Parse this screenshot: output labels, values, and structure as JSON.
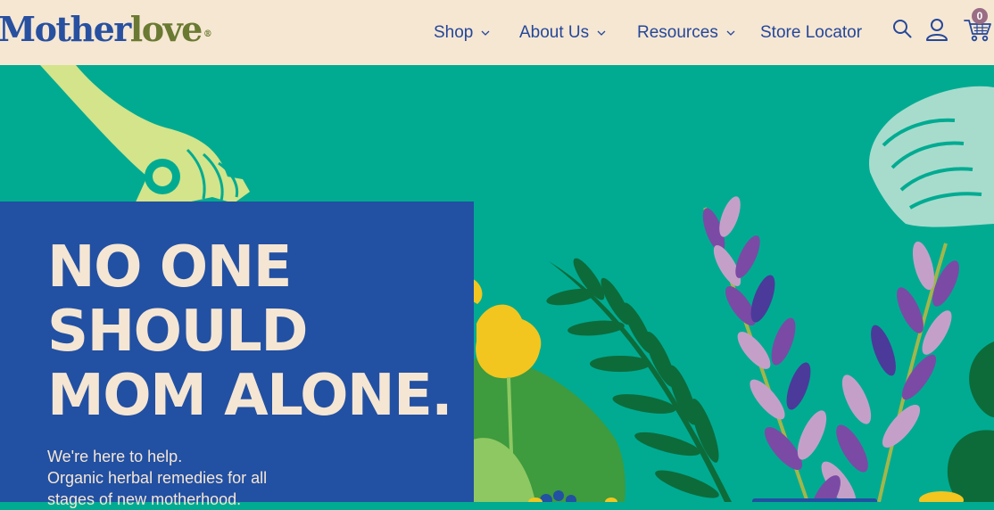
{
  "brand": {
    "name_part1": "Mother",
    "name_part2": "love",
    "registered": "®"
  },
  "nav": {
    "items": [
      {
        "label": "Shop",
        "has_dropdown": true
      },
      {
        "label": "About Us",
        "has_dropdown": true
      },
      {
        "label": "Resources",
        "has_dropdown": true
      },
      {
        "label": "Store Locator",
        "has_dropdown": false
      }
    ],
    "chevron_glyph": "⌵"
  },
  "header_icons": {
    "search": "search-icon",
    "account": "user-icon",
    "cart": "cart-icon",
    "cart_count": "0"
  },
  "hero": {
    "headline": [
      "NO ONE",
      "SHOULD",
      "MOM ALONE."
    ],
    "sub": [
      "We're here to help.",
      "Organic herbal remedies for all",
      "stages of new motherhood."
    ]
  },
  "colors": {
    "header_bg": "#f6e7d3",
    "brand_blue": "#2850a0",
    "brand_green": "#6a7a32",
    "nav_text": "#24479a",
    "hero_bg": "#00ab92",
    "panel_blue": "#2250a3",
    "headline_cream": "#f5e6d3",
    "cart_badge": "#9a6d84"
  }
}
